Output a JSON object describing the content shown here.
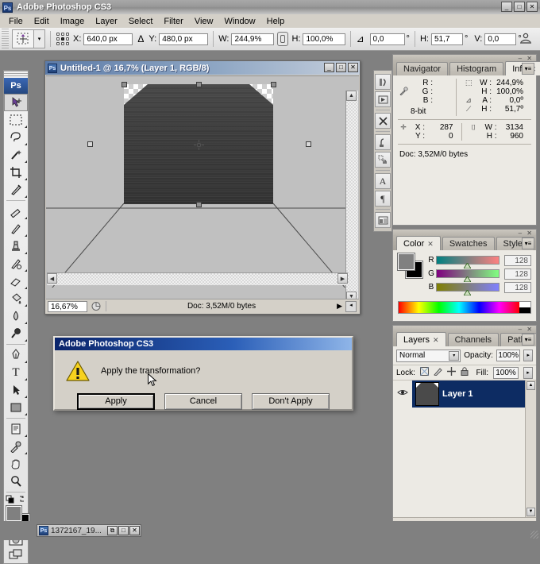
{
  "app": {
    "title": "Adobe Photoshop CS3",
    "logo_text": "Ps",
    "window_buttons": [
      {
        "name": "minimize",
        "glyph": "_"
      },
      {
        "name": "maximize",
        "glyph": "□"
      },
      {
        "name": "close",
        "glyph": "✕"
      }
    ]
  },
  "menubar": {
    "items": [
      "File",
      "Edit",
      "Image",
      "Layer",
      "Select",
      "Filter",
      "View",
      "Window",
      "Help"
    ]
  },
  "options_bar": {
    "tool_preset_icon": "move-tool-icon",
    "reference_point_label": "reference-point-locator",
    "fields": [
      {
        "label": "X:",
        "value": "640,0 px",
        "width": 62
      },
      {
        "label": "Y:",
        "value": "480,0 px",
        "width": 62
      },
      {
        "label": "W:",
        "value": "244,9%",
        "width": 54
      },
      {
        "label": "H:",
        "value": "100,0%",
        "width": 54
      },
      {
        "label": "",
        "value": "0,0",
        "width": 44,
        "unit": "°"
      },
      {
        "label": "H:",
        "value": "51,7",
        "width": 40,
        "unit": "°"
      },
      {
        "label": "V:",
        "value": "0,0",
        "width": 40,
        "unit": "°"
      }
    ],
    "delta_symbol": "Δ",
    "angle_symbol": "⊿",
    "bridge_icon": "go-to-bridge-icon"
  },
  "toolbox": {
    "logo": "Ps",
    "tools": [
      {
        "name": "move-tool",
        "glyph": "✥",
        "selected": true,
        "has_flyout": false
      },
      {
        "name": "rectangular-marquee-tool",
        "glyph": "▢",
        "selected": false,
        "has_flyout": true
      },
      {
        "name": "lasso-tool",
        "glyph": "𝒫",
        "selected": false,
        "has_flyout": true
      },
      {
        "name": "magic-wand-tool",
        "glyph": "✧",
        "selected": false,
        "has_flyout": true
      },
      {
        "name": "crop-tool",
        "glyph": "⌗",
        "selected": false,
        "has_flyout": true
      },
      {
        "name": "slice-tool",
        "glyph": "✂",
        "selected": false,
        "has_flyout": true
      },
      {
        "name": "healing-brush-tool",
        "glyph": "✎",
        "selected": false,
        "has_flyout": true
      },
      {
        "name": "brush-tool",
        "glyph": "🖌",
        "selected": false,
        "has_flyout": true
      },
      {
        "name": "clone-stamp-tool",
        "glyph": "⎈",
        "selected": false,
        "has_flyout": true
      },
      {
        "name": "history-brush-tool",
        "glyph": "✒",
        "selected": false,
        "has_flyout": true
      },
      {
        "name": "eraser-tool",
        "glyph": "▱",
        "selected": false,
        "has_flyout": true
      },
      {
        "name": "gradient-tool",
        "glyph": "◨",
        "selected": false,
        "has_flyout": true
      },
      {
        "name": "blur-tool",
        "glyph": "💧",
        "selected": false,
        "has_flyout": true
      },
      {
        "name": "dodge-tool",
        "glyph": "🔍",
        "selected": false,
        "has_flyout": true
      },
      {
        "name": "pen-tool",
        "glyph": "✑",
        "selected": false,
        "has_flyout": true
      },
      {
        "name": "horizontal-type-tool",
        "glyph": "T",
        "selected": false,
        "has_flyout": true
      },
      {
        "name": "path-selection-tool",
        "glyph": "➤",
        "selected": false,
        "has_flyout": true
      },
      {
        "name": "rectangle-tool",
        "glyph": "▣",
        "selected": false,
        "has_flyout": true
      },
      {
        "name": "notes-tool",
        "glyph": "🗒",
        "selected": false,
        "has_flyout": true
      },
      {
        "name": "eyedropper-tool",
        "glyph": "⚲",
        "selected": false,
        "has_flyout": true
      },
      {
        "name": "hand-tool",
        "glyph": "✋",
        "selected": false,
        "has_flyout": false
      },
      {
        "name": "zoom-tool",
        "glyph": "🔎",
        "selected": false,
        "has_flyout": false
      }
    ],
    "foreground_color": "#808080",
    "background_color": "#000000",
    "quick_mask_icon": "quick-mask-mode-icon",
    "screen_mode_icon": "screen-mode-icon"
  },
  "document": {
    "title": "Untitled-1 @ 16,7% (Layer 1, RGB/8)",
    "window_buttons": [
      {
        "name": "minimize",
        "glyph": "_"
      },
      {
        "name": "maximize",
        "glyph": "□"
      },
      {
        "name": "close",
        "glyph": "✕"
      }
    ],
    "zoom": "16,67%",
    "status": "Doc: 3,52M/0 bytes",
    "transform_handles": 8,
    "center_marker": "transform-center-point"
  },
  "icon_dock": {
    "items": [
      {
        "name": "history-panel-icon",
        "glyph": "↻"
      },
      {
        "name": "actions-panel-icon",
        "glyph": "▶"
      },
      {
        "name": "tool-presets-panel-icon",
        "glyph": "✕"
      },
      {
        "name": "brushes-panel-icon",
        "glyph": "⑂"
      },
      {
        "name": "clone-source-panel-icon",
        "glyph": "⧉"
      },
      {
        "name": "character-panel-icon",
        "glyph": "A"
      },
      {
        "name": "paragraph-panel-icon",
        "glyph": "¶"
      },
      {
        "name": "layer-comps-panel-icon",
        "glyph": "▤"
      }
    ]
  },
  "info_panel": {
    "tabs": [
      {
        "label": "Navigator",
        "active": false,
        "closable": false
      },
      {
        "label": "Histogram",
        "active": false,
        "closable": false
      },
      {
        "label": "Info",
        "active": true,
        "closable": true
      }
    ],
    "left_readout": [
      {
        "key": "R :",
        "value": ""
      },
      {
        "key": "G :",
        "value": ""
      },
      {
        "key": "B :",
        "value": ""
      }
    ],
    "right_readout": [
      {
        "key": "W :",
        "value": "244,9%"
      },
      {
        "key": "H :",
        "value": "100,0%"
      },
      {
        "key": "A :",
        "value": "0,0º"
      },
      {
        "key": "H :",
        "value": "51,7º"
      }
    ],
    "bit_depth": "8-bit",
    "position": [
      {
        "key": "X :",
        "value": "287"
      },
      {
        "key": "Y :",
        "value": "0"
      }
    ],
    "size": [
      {
        "key": "W :",
        "value": "3134"
      },
      {
        "key": "H :",
        "value": "960"
      }
    ],
    "doc_info": "Doc: 3,52M/0 bytes"
  },
  "color_panel": {
    "tabs": [
      {
        "label": "Color",
        "active": true,
        "closable": true
      },
      {
        "label": "Swatches",
        "active": false,
        "closable": false
      },
      {
        "label": "Styles",
        "active": false,
        "closable": false
      }
    ],
    "foreground_color": "#808080",
    "background_color": "#000000",
    "channels": [
      {
        "letter": "R",
        "value": "128"
      },
      {
        "letter": "G",
        "value": "128"
      },
      {
        "letter": "B",
        "value": "128"
      }
    ]
  },
  "layers_panel": {
    "tabs": [
      {
        "label": "Layers",
        "active": true,
        "closable": true
      },
      {
        "label": "Channels",
        "active": false,
        "closable": false
      },
      {
        "label": "Paths",
        "active": false,
        "closable": false
      }
    ],
    "blend_mode": "Normal",
    "opacity_label": "Opacity:",
    "opacity_value": "100%",
    "lock_label": "Lock:",
    "lock_icons": [
      {
        "name": "lock-transparent-pixels-icon",
        "glyph": "⊠"
      },
      {
        "name": "lock-image-pixels-icon",
        "glyph": "✎"
      },
      {
        "name": "lock-position-icon",
        "glyph": "✥"
      },
      {
        "name": "lock-all-icon",
        "glyph": "🔒"
      }
    ],
    "fill_label": "Fill:",
    "fill_value": "100%",
    "layers": [
      {
        "name": "Layer 1",
        "visible": true,
        "selected": true
      }
    ],
    "bottom_buttons": [
      {
        "name": "link-layers-icon",
        "glyph": "⚭"
      },
      {
        "name": "layer-style-icon",
        "glyph": "fx"
      },
      {
        "name": "layer-mask-icon",
        "glyph": "◙"
      },
      {
        "name": "adjustment-layer-icon",
        "glyph": "◑"
      },
      {
        "name": "new-group-icon",
        "glyph": "🗀"
      },
      {
        "name": "new-layer-icon",
        "glyph": "▣"
      },
      {
        "name": "delete-layer-icon",
        "glyph": "🗑"
      }
    ]
  },
  "dialog": {
    "title": "Adobe Photoshop CS3",
    "icon": "warning-icon",
    "message": "Apply the transformation?",
    "buttons": [
      {
        "label": "Apply",
        "default": true
      },
      {
        "label": "Cancel",
        "default": false
      },
      {
        "label": "Don't Apply",
        "default": false
      }
    ]
  },
  "taskbar": {
    "item_label": "1372167_19...",
    "item_icon": "Ps",
    "buttons": [
      {
        "name": "restore",
        "glyph": "⧉"
      },
      {
        "name": "maximize",
        "glyph": "□"
      },
      {
        "name": "close",
        "glyph": "✕"
      }
    ]
  }
}
